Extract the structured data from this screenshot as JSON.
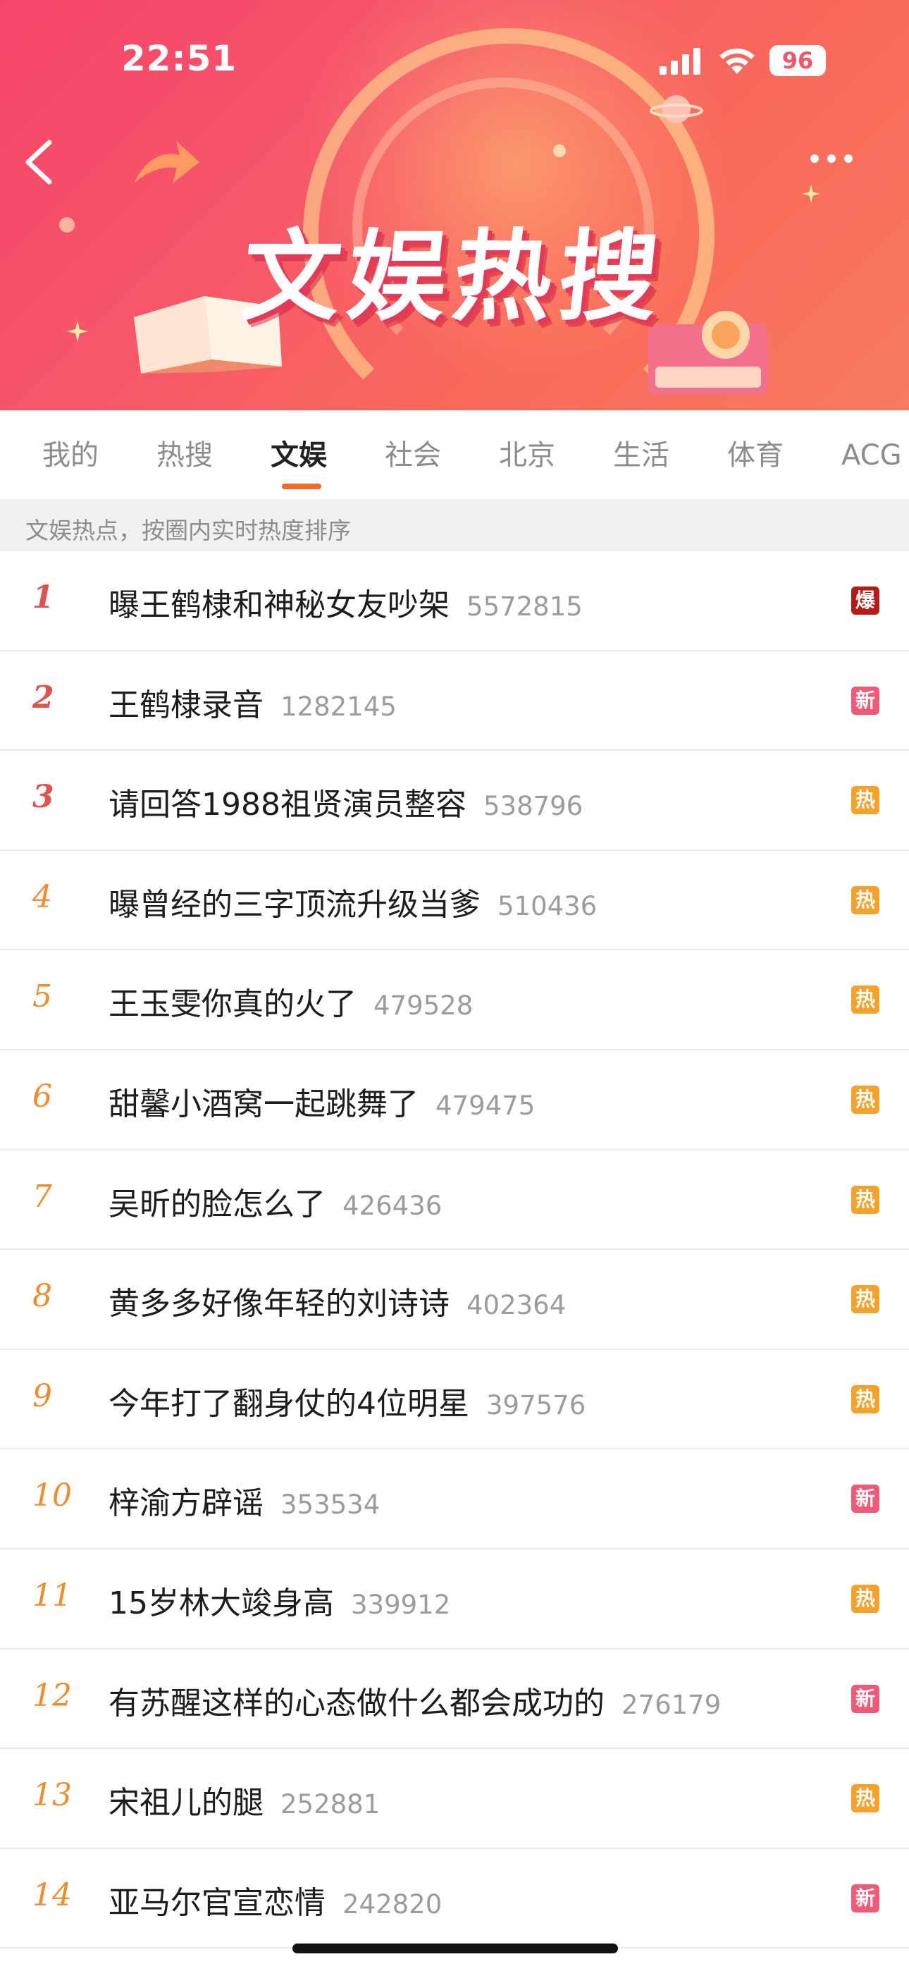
{
  "status_bar": {
    "time": "22:51",
    "battery": "96"
  },
  "banner": {
    "title": "文娱热搜"
  },
  "tabs": [
    {
      "label": "我的",
      "active": false
    },
    {
      "label": "热搜",
      "active": false
    },
    {
      "label": "文娱",
      "active": true
    },
    {
      "label": "社会",
      "active": false
    },
    {
      "label": "北京",
      "active": false
    },
    {
      "label": "生活",
      "active": false
    },
    {
      "label": "体育",
      "active": false
    },
    {
      "label": "ACG",
      "active": false
    }
  ],
  "subheader": "文娱热点，按圈内实时热度排序",
  "badge_colors": {
    "爆": "#b31b14",
    "新": "#ee5b78",
    "热": "#f5a22c"
  },
  "items": [
    {
      "rank": "1",
      "title": "曝王鹤棣和神秘女友吵架",
      "count": "5572815",
      "badge": "爆"
    },
    {
      "rank": "2",
      "title": "王鹤棣录音",
      "count": "1282145",
      "badge": "新"
    },
    {
      "rank": "3",
      "title": "请回答1988祖贤演员整容",
      "count": "538796",
      "badge": "热"
    },
    {
      "rank": "4",
      "title": "曝曾经的三字顶流升级当爹",
      "count": "510436",
      "badge": "热"
    },
    {
      "rank": "5",
      "title": "王玉雯你真的火了",
      "count": "479528",
      "badge": "热"
    },
    {
      "rank": "6",
      "title": "甜馨小酒窝一起跳舞了",
      "count": "479475",
      "badge": "热"
    },
    {
      "rank": "7",
      "title": "吴昕的脸怎么了",
      "count": "426436",
      "badge": "热"
    },
    {
      "rank": "8",
      "title": "黄多多好像年轻的刘诗诗",
      "count": "402364",
      "badge": "热"
    },
    {
      "rank": "9",
      "title": "今年打了翻身仗的4位明星",
      "count": "397576",
      "badge": "热"
    },
    {
      "rank": "10",
      "title": "梓渝方辟谣",
      "count": "353534",
      "badge": "新"
    },
    {
      "rank": "11",
      "title": "15岁林大竣身高",
      "count": "339912",
      "badge": "热"
    },
    {
      "rank": "12",
      "title": "有苏醒这样的心态做什么都会成功的",
      "count": "276179",
      "badge": "新"
    },
    {
      "rank": "13",
      "title": "宋祖儿的腿",
      "count": "252881",
      "badge": "热"
    },
    {
      "rank": "14",
      "title": "亚马尔官宣恋情",
      "count": "242820",
      "badge": "新"
    }
  ]
}
